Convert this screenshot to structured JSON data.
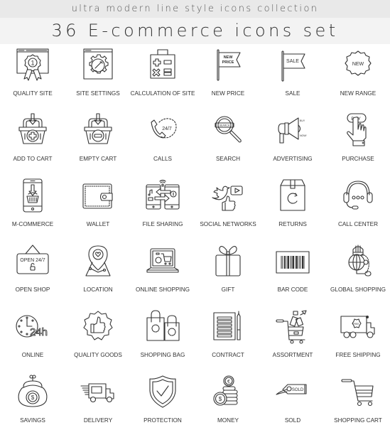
{
  "header": {
    "subtitle": "ultra modern line style icons collection",
    "title": "36 E-commerce icons set"
  },
  "colors": {
    "background": "#ffffff",
    "header_top_bg": "#e9e9e9",
    "header_main_bg": "#f3f3f3",
    "line": "#333333"
  },
  "icons": [
    {
      "label": "QUALITY SITE",
      "icon": "award-ribbon-browser-icon",
      "badge_text": "1"
    },
    {
      "label": "SITE SETTINGS",
      "icon": "gear-wrench-browser-icon"
    },
    {
      "label": "CALCULATION OF SITE",
      "icon": "calculator-bag-icon"
    },
    {
      "label": "NEW PRICE",
      "icon": "flag-icon",
      "flag_text_1": "NEW",
      "flag_text_2": "PRICE"
    },
    {
      "label": "SALE",
      "icon": "flag-icon",
      "flag_text_1": "SALE"
    },
    {
      "label": "NEW RANGE",
      "icon": "starburst-badge-icon",
      "badge_text": "NEW"
    },
    {
      "label": "ADD TO CART",
      "icon": "basket-plus-icon"
    },
    {
      "label": "EMPTY CART",
      "icon": "basket-minus-icon"
    },
    {
      "label": "CALLS",
      "icon": "phone-24-7-icon",
      "badge_text": "24/7"
    },
    {
      "label": "SEARCH",
      "icon": "magnifier-icon",
      "badge_text": "SEARCH"
    },
    {
      "label": "ADVERTISING",
      "icon": "megaphone-icon",
      "text_1": "BUY",
      "text_2": "NOW!"
    },
    {
      "label": "PURCHASE",
      "icon": "hand-buy-button-icon",
      "badge_text": "BUY"
    },
    {
      "label": "M-COMMERCE",
      "icon": "smartphone-basket-icon"
    },
    {
      "label": "WALLET",
      "icon": "wallet-icon"
    },
    {
      "label": "FILE SHARING",
      "icon": "phones-exchange-icon"
    },
    {
      "label": "SOCIAL NETWORKS",
      "icon": "social-bird-play-like-icon"
    },
    {
      "label": "RETURNS",
      "icon": "box-return-icon"
    },
    {
      "label": "CALL CENTER",
      "icon": "headset-icon"
    },
    {
      "label": "OPEN SHOP",
      "icon": "open-sign-icon",
      "badge_text": "OPEN 24/7"
    },
    {
      "label": "LOCATION",
      "icon": "map-pin-heart-icon"
    },
    {
      "label": "ONLINE SHOPPING",
      "icon": "laptop-cart-icon"
    },
    {
      "label": "GIFT",
      "icon": "gift-box-icon"
    },
    {
      "label": "BAR CODE",
      "icon": "barcode-icon"
    },
    {
      "label": "GLOBAL SHOPPING",
      "icon": "globe-shop-icon"
    },
    {
      "label": "ONLINE",
      "icon": "clock-24h-icon",
      "badge_text": "24h"
    },
    {
      "label": "QUALITY GOODS",
      "icon": "thumbs-up-badge-icon"
    },
    {
      "label": "SHOPPING BAG",
      "icon": "shopping-bags-icon"
    },
    {
      "label": "CONTRACT",
      "icon": "document-pen-icon"
    },
    {
      "label": "ASSORTMENT",
      "icon": "cart-products-icon"
    },
    {
      "label": "FREE SHIPPING",
      "icon": "truck-free-icon",
      "badge_text": "FREE"
    },
    {
      "label": "SAVINGS",
      "icon": "purse-dollar-icon",
      "badge_text": "$"
    },
    {
      "label": "DELIVERY",
      "icon": "speeding-truck-icon"
    },
    {
      "label": "PROTECTION",
      "icon": "shield-check-icon"
    },
    {
      "label": "MONEY",
      "icon": "coins-stack-icon",
      "text_1": "€",
      "text_2": "$"
    },
    {
      "label": "SOLD",
      "icon": "sold-tag-icon",
      "badge_text": "SOLD"
    },
    {
      "label": "SHOPPING CART",
      "icon": "shopping-cart-icon"
    }
  ]
}
